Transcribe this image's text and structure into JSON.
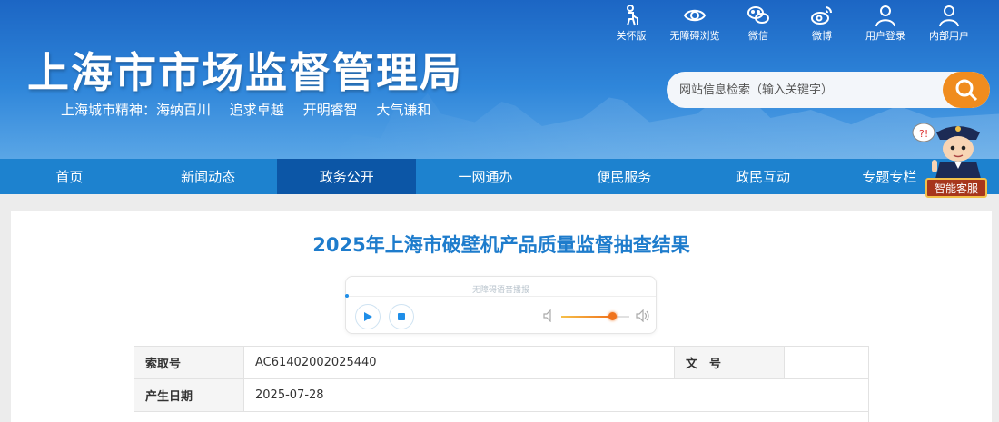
{
  "header": {
    "site_title": "上海市市场监督管理局",
    "motto": [
      "上海城市精神：海纳百川",
      "追求卓越",
      "开明睿智",
      "大气谦和"
    ],
    "toolbar": [
      {
        "label": "关怀版",
        "icon": "elderly-icon"
      },
      {
        "label": "无障碍浏览",
        "icon": "eye-icon"
      },
      {
        "label": "微信",
        "icon": "wechat-icon"
      },
      {
        "label": "微博",
        "icon": "weibo-icon"
      },
      {
        "label": "用户登录",
        "icon": "user-icon"
      },
      {
        "label": "内部用户",
        "icon": "user-icon"
      }
    ],
    "search_placeholder": "网站信息检索（输入关键字）",
    "service_label": "智能客服"
  },
  "nav": {
    "items": [
      "首页",
      "新闻动态",
      "政务公开",
      "一网通办",
      "便民服务",
      "政民互动",
      "专题专栏"
    ],
    "active": "政务公开"
  },
  "article": {
    "title": "2025年上海市破壁机产品质量监督抽查结果",
    "player_label": "无障碍语音播报",
    "volume": 0.75
  },
  "meta": {
    "index_label": "索取号",
    "index_value": "AC61402002025440",
    "doc_no_label": "文　号",
    "doc_no_value": "",
    "date_label": "产生日期",
    "date_value": "2025-07-28"
  },
  "colors": {
    "header_blue": "#1c66c4",
    "nav_blue": "#1d82cf",
    "nav_active": "#0c56a6",
    "title_blue": "#1e7ccc",
    "search_orange": "#f08c1e"
  }
}
